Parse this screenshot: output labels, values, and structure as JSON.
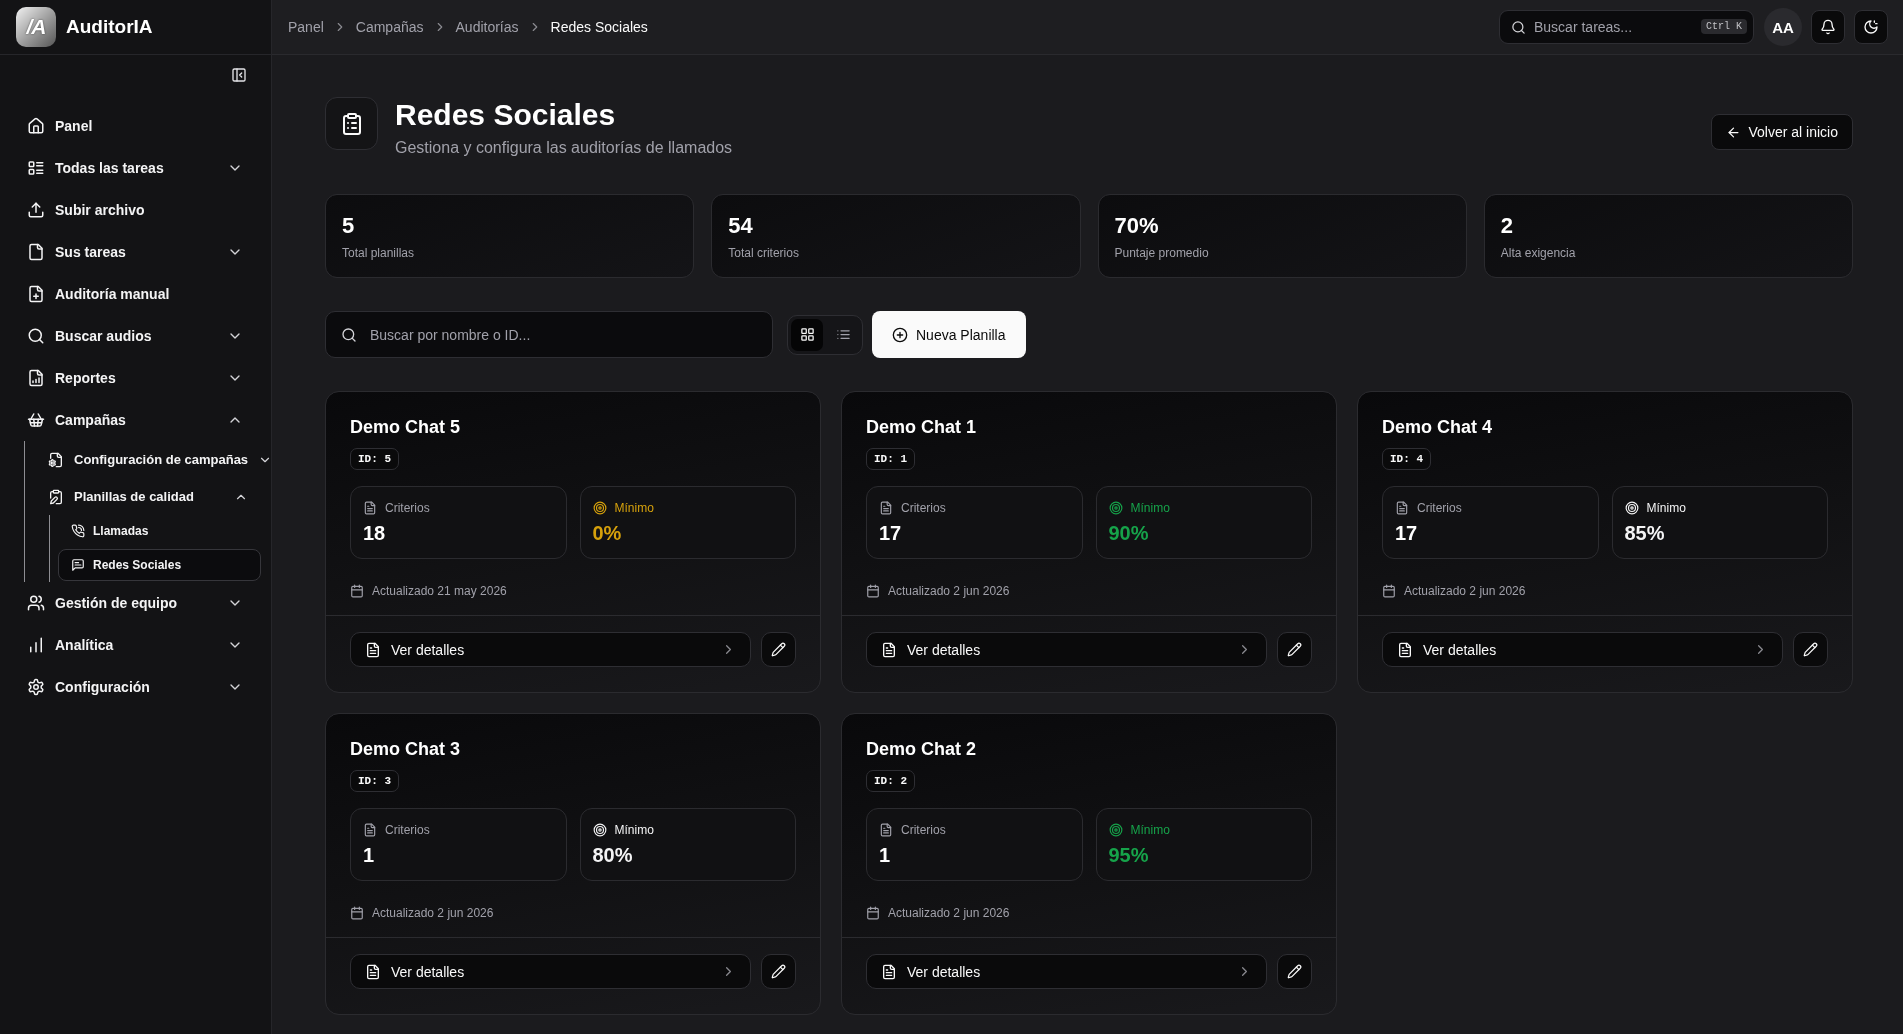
{
  "sidebar": {
    "brand": {
      "logo_mark": "/A",
      "name": "AuditorIA"
    },
    "items": [
      {
        "label": "Panel",
        "kind": "link",
        "selected": false
      },
      {
        "label": "Todas las tareas",
        "kind": "group",
        "expanded": false,
        "selected": false
      },
      {
        "label": "Subir archivo",
        "kind": "link",
        "selected": false
      },
      {
        "label": "Sus tareas",
        "kind": "group",
        "expanded": false,
        "selected": false
      },
      {
        "label": "Auditoría manual",
        "kind": "link",
        "selected": false
      },
      {
        "label": "Buscar audios",
        "kind": "group",
        "expanded": false,
        "selected": false
      },
      {
        "label": "Reportes",
        "kind": "group",
        "expanded": false,
        "selected": false
      },
      {
        "label": "Campañas",
        "kind": "group",
        "expanded": true,
        "selected": false,
        "children": [
          {
            "label": "Configuración de campañas",
            "kind": "group",
            "expanded": false,
            "selected": false
          },
          {
            "label": "Planillas de calidad",
            "kind": "group",
            "expanded": true,
            "selected": false,
            "children": [
              {
                "label": "Llamadas",
                "kind": "link",
                "selected": false
              },
              {
                "label": "Redes Sociales",
                "kind": "link",
                "selected": true
              }
            ]
          }
        ]
      },
      {
        "label": "Gestión de equipo",
        "kind": "group",
        "expanded": false,
        "selected": false
      },
      {
        "label": "Analítica",
        "kind": "group",
        "expanded": false,
        "selected": false
      },
      {
        "label": "Configuración",
        "kind": "group",
        "expanded": false,
        "selected": false
      }
    ]
  },
  "header": {
    "breadcrumb": [
      {
        "label": "Panel",
        "current": false
      },
      {
        "label": "Campañas",
        "current": false
      },
      {
        "label": "Auditorías",
        "current": false
      },
      {
        "label": "Redes Sociales",
        "current": true
      }
    ],
    "search": {
      "placeholder": "Buscar tareas...",
      "shortcut": "Ctrl K"
    },
    "avatar": "AA"
  },
  "page": {
    "title": "Redes Sociales",
    "subtitle": "Gestiona y configura las auditorías de llamados",
    "back_button": "Volver al inicio"
  },
  "stats": [
    {
      "value": "5",
      "label": "Total planillas"
    },
    {
      "value": "54",
      "label": "Total criterios"
    },
    {
      "value": "70%",
      "label": "Puntaje promedio"
    },
    {
      "value": "2",
      "label": "Alta exigencia"
    }
  ],
  "toolbar": {
    "search": {
      "placeholder": "Buscar por nombre o ID..."
    },
    "view_modes": [
      {
        "kind": "grid",
        "selected": true
      },
      {
        "kind": "list",
        "selected": false
      }
    ],
    "new_button": "Nueva Planilla"
  },
  "templates": [
    {
      "title": "Demo Chat 5",
      "id_tag": "ID: 5",
      "criteria": {
        "label": "Criterios",
        "value": "18"
      },
      "minimum": {
        "label": "Mínimo",
        "value": "0%",
        "color": "#d6a10c"
      },
      "updated": "Actualizado 21 may 2026",
      "details_button": "Ver detalles"
    },
    {
      "title": "Demo Chat 1",
      "id_tag": "ID: 1",
      "criteria": {
        "label": "Criterios",
        "value": "17"
      },
      "minimum": {
        "label": "Mínimo",
        "value": "90%",
        "color": "#16a34a"
      },
      "updated": "Actualizado 2 jun 2026",
      "details_button": "Ver detalles"
    },
    {
      "title": "Demo Chat 4",
      "id_tag": "ID: 4",
      "criteria": {
        "label": "Criterios",
        "value": "17"
      },
      "minimum": {
        "label": "Mínimo",
        "value": "85%",
        "color": "#f4f4f5"
      },
      "updated": "Actualizado 2 jun 2026",
      "details_button": "Ver detalles"
    },
    {
      "title": "Demo Chat 3",
      "id_tag": "ID: 3",
      "criteria": {
        "label": "Criterios",
        "value": "1"
      },
      "minimum": {
        "label": "Mínimo",
        "value": "80%",
        "color": "#f4f4f5"
      },
      "updated": "Actualizado 2 jun 2026",
      "details_button": "Ver detalles"
    },
    {
      "title": "Demo Chat 2",
      "id_tag": "ID: 2",
      "criteria": {
        "label": "Criterios",
        "value": "1"
      },
      "minimum": {
        "label": "Mínimo",
        "value": "95%",
        "color": "#16a34a"
      },
      "updated": "Actualizado 2 jun 2026",
      "details_button": "Ver detalles"
    }
  ]
}
